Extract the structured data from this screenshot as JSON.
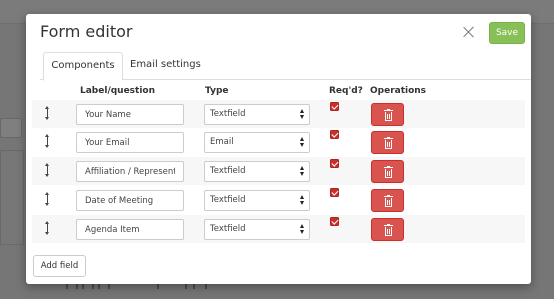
{
  "modal": {
    "title": "Form editor",
    "save_label": "Save"
  },
  "tabs": [
    {
      "label": "Components",
      "active": true
    },
    {
      "label": "Email settings",
      "active": false
    }
  ],
  "table": {
    "headers": {
      "label": "Label/question",
      "type": "Type",
      "required": "Req'd?",
      "operations": "Operations"
    },
    "rows": [
      {
        "label": "Your Name",
        "type": "Textfield",
        "required": true
      },
      {
        "label": "Your Email",
        "type": "Email",
        "required": true
      },
      {
        "label": "Affiliation / Representa",
        "type": "Textfield",
        "required": true
      },
      {
        "label": "Date of Meeting",
        "type": "Textfield",
        "required": true
      },
      {
        "label": "Agenda Item",
        "type": "Textfield",
        "required": true
      }
    ]
  },
  "add_field_label": "Add field",
  "colors": {
    "save": "#88c057",
    "danger": "#d9534f",
    "overlay": "rgba(0,0,0,0.5)"
  }
}
